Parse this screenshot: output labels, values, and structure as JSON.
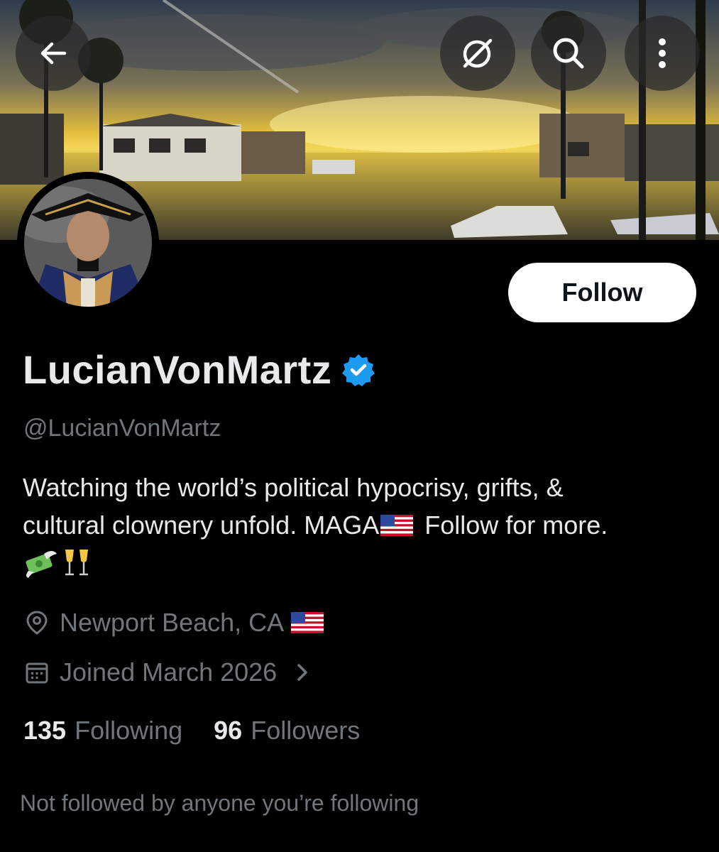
{
  "header": {
    "back_icon": "arrow-left-icon",
    "grok_icon": "grok-icon",
    "search_icon": "search-icon",
    "more_icon": "more-vertical-icon"
  },
  "profile": {
    "display_name": "LucianVonMartz",
    "handle": "@LucianVonMartz",
    "verified": true,
    "follow_label": "Follow",
    "bio_line1": "Watching the world’s political hypocrisy, grifts, &",
    "bio_line2_a": "cultural clownery unfold. MAGA",
    "bio_line2_b": " Follow for more.",
    "location": "Newport Beach, CA",
    "joined": "Joined March 2026"
  },
  "stats": {
    "following_count": "135",
    "following_label": "Following",
    "followers_count": "96",
    "followers_label": "Followers"
  },
  "footer": {
    "mutuals_text": "Not followed by anyone you’re following"
  },
  "colors": {
    "background": "#000000",
    "primary_text": "#e7e9ea",
    "secondary_text": "#71767b",
    "verified_blue": "#1d9bf0"
  }
}
